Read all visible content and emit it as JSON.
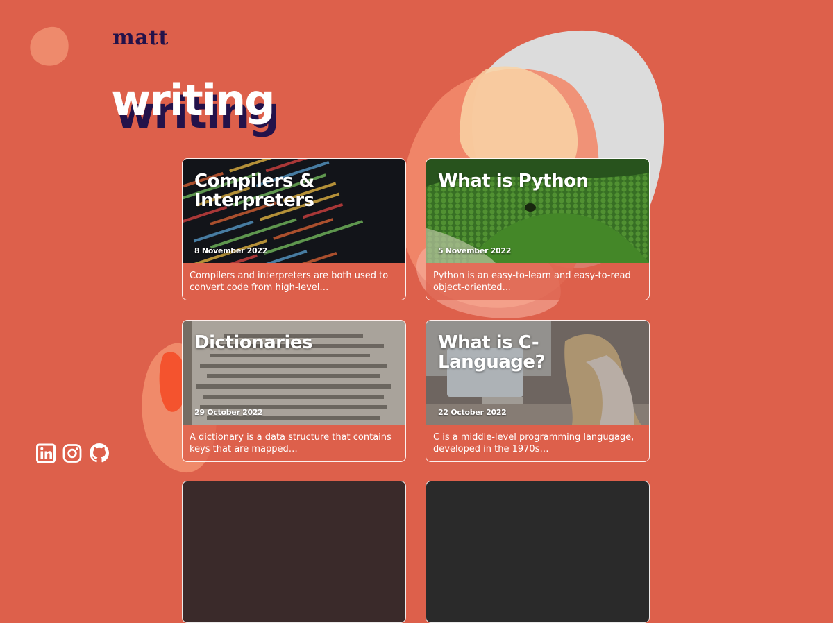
{
  "brand": {
    "logo": "matt"
  },
  "page": {
    "heading": "writing"
  },
  "articles": [
    {
      "title": "Compilers & Interpreters",
      "date": "8 November 2022",
      "excerpt": "Compilers and interpreters are both used to convert code from high-level…",
      "image": "code-screen"
    },
    {
      "title": "What is Python",
      "date": "5 November 2022",
      "excerpt": "Python is an easy-to-learn and easy-to-read object-oriented…",
      "image": "green-python-snake"
    },
    {
      "title": "Dictionaries",
      "date": "29 October 2022",
      "excerpt": "A dictionary is a data structure that contains keys that are mapped…",
      "image": "dictionary-page"
    },
    {
      "title": "What is C-Language?",
      "date": "22 October 2022",
      "excerpt": "C is a middle-level programming langugage, developed in the 1970s…",
      "image": "woman-at-computer"
    }
  ],
  "social": [
    {
      "name": "linkedin-icon"
    },
    {
      "name": "instagram-icon"
    },
    {
      "name": "github-icon"
    }
  ],
  "colors": {
    "background": "#dd604b",
    "navy": "#23124a",
    "blob_peach": "#f08a6a",
    "blob_grey": "#dcdcdc",
    "blob_cream": "#f9d1a7"
  }
}
